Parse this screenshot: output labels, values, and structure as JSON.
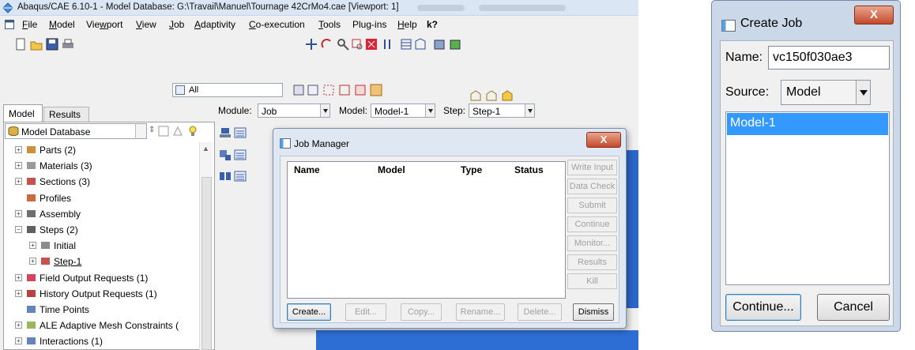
{
  "main_window": {
    "title": "Abaqus/CAE 6.10-1 - Model Database: G:\\Travail\\Manuel\\Tournage 42CrMo4.cae [Viewport: 1]",
    "menus": [
      {
        "pre": "",
        "ul": "F",
        "post": "ile"
      },
      {
        "pre": "",
        "ul": "M",
        "post": "odel"
      },
      {
        "pre": "Vie",
        "ul": "w",
        "post": "port"
      },
      {
        "pre": "",
        "ul": "V",
        "post": "iew"
      },
      {
        "pre": "",
        "ul": "J",
        "post": "ob"
      },
      {
        "pre": "",
        "ul": "A",
        "post": "daptivity"
      },
      {
        "pre": "",
        "ul": "C",
        "post": "o-execution"
      },
      {
        "pre": "",
        "ul": "T",
        "post": "ools"
      },
      {
        "pre": "Plu",
        "ul": "g",
        "post": "-ins"
      },
      {
        "pre": "",
        "ul": "H",
        "post": "elp"
      }
    ],
    "help_arrow": "k?",
    "selection_filter": "All"
  },
  "tabs": {
    "model": "Model",
    "results": "Results"
  },
  "tree": {
    "root": "Model Database",
    "items": [
      {
        "label": "Parts (2)",
        "exp": "⊞",
        "icon": "parts-icon"
      },
      {
        "label": "Materials (3)",
        "exp": "⊞",
        "icon": "materials-icon"
      },
      {
        "label": "Sections (3)",
        "exp": "⊞",
        "icon": "sections-icon"
      },
      {
        "label": "Profiles",
        "exp": "",
        "icon": "profiles-icon"
      },
      {
        "label": "Assembly",
        "exp": "⊞",
        "icon": "assembly-icon"
      },
      {
        "label": "Steps (2)",
        "exp": "⊟",
        "icon": "steps-icon"
      },
      {
        "label": "Initial",
        "exp": "⊞",
        "icon": "initial-step-icon"
      },
      {
        "label": "Step-1",
        "exp": "⊞",
        "icon": "step-icon"
      },
      {
        "label": "Field Output Requests (1)",
        "exp": "⊞",
        "icon": "field-output-icon"
      },
      {
        "label": "History Output Requests (1)",
        "exp": "⊞",
        "icon": "history-output-icon"
      },
      {
        "label": "Time Points",
        "exp": "",
        "icon": "time-points-icon"
      },
      {
        "label": "ALE Adaptive Mesh Constraints (",
        "exp": "⊞",
        "icon": "ale-icon"
      },
      {
        "label": "Interactions (1)",
        "exp": "⊞",
        "icon": "interactions-icon"
      }
    ]
  },
  "context": {
    "module_label": "Module:",
    "module_value": "Job",
    "model_label": "Model:",
    "model_value": "Model-1",
    "step_label": "Step:",
    "step_value": "Step-1"
  },
  "job_manager": {
    "title": "Job Manager",
    "close": "X",
    "columns": [
      "Name",
      "Model",
      "Type",
      "Status"
    ],
    "side_buttons": [
      "Write Input",
      "Data Check",
      "Submit",
      "Continue",
      "Monitor...",
      "Results",
      "Kill"
    ],
    "bottom_buttons": {
      "create": "Create...",
      "edit": "Edit...",
      "copy": "Copy...",
      "rename": "Rename...",
      "delete": "Delete...",
      "dismiss": "Dismiss"
    }
  },
  "create_job": {
    "title": "Create Job",
    "close": "X",
    "name_label": "Name:",
    "name_value": "vc150f030ae3",
    "source_label": "Source:",
    "source_value": "Model",
    "models": [
      "Model-1"
    ],
    "continue": "Continue...",
    "cancel": "Cancel"
  },
  "colors": {
    "selection": "#3399ff",
    "close_button": "#c44a2c",
    "viewport": "#2a67c9"
  }
}
